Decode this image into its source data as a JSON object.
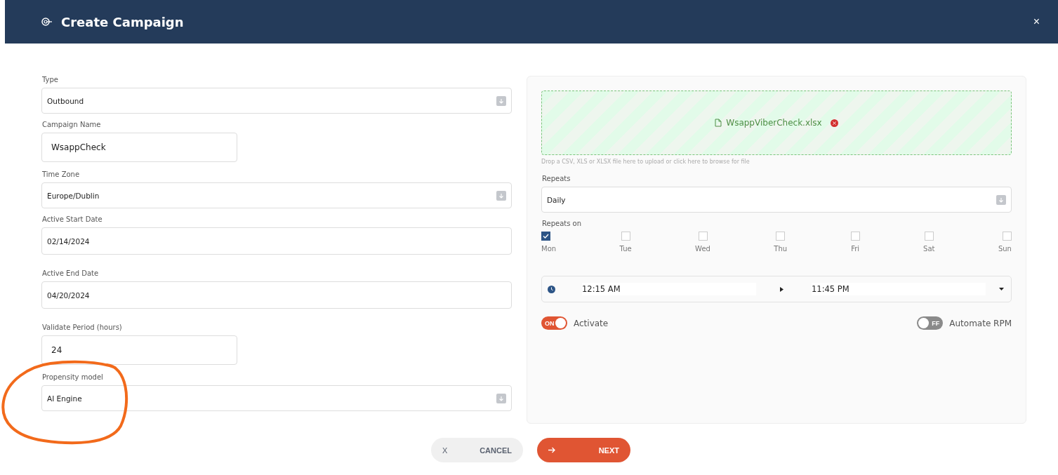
{
  "header": {
    "title": "Create Campaign",
    "close": "×"
  },
  "left_fields": [
    {
      "kind": "select",
      "label": "Type",
      "value": "Outbound"
    },
    {
      "kind": "input",
      "label": "Campaign Name",
      "value": "WsappCheck",
      "short": true
    },
    {
      "kind": "select",
      "label": "Time Zone",
      "value": "Europe/Dublin"
    },
    {
      "kind": "date",
      "label": "Active Start Date",
      "value": "02/14/2024"
    },
    {
      "kind": "date",
      "label": "Active End Date",
      "value": "04/20/2024"
    },
    {
      "kind": "input",
      "label": "Validate Period (hours)",
      "value": "24",
      "short": true
    },
    {
      "kind": "select",
      "label": "Propensity model",
      "value": "AI Engine",
      "circled": true
    }
  ],
  "upload": {
    "file": "WsappViberCheck.xlsx",
    "hint": "Drop a CSV, XLS or XLSX file here to upload or click here to browse for file"
  },
  "repeats": {
    "label": "Repeats",
    "value": "Daily"
  },
  "repeats_on": {
    "label": "Repeats on",
    "days": [
      {
        "label": "Mon",
        "checked": true
      },
      {
        "label": "Tue",
        "checked": false
      },
      {
        "label": "Wed",
        "checked": false
      },
      {
        "label": "Thu",
        "checked": false
      },
      {
        "label": "Fri",
        "checked": false
      },
      {
        "label": "Sat",
        "checked": false
      },
      {
        "label": "Sun",
        "checked": false
      }
    ]
  },
  "time_range": {
    "start": "12:15 AM",
    "end": "11:45 PM"
  },
  "toggles": [
    {
      "label": "Activate",
      "on": true,
      "text": "ON"
    },
    {
      "label": "Automate RPM",
      "on": false,
      "text": "FF"
    }
  ],
  "buttons": [
    {
      "kind": "cancel",
      "icon": "X",
      "label": "CANCEL"
    },
    {
      "kind": "next",
      "label": "NEXT"
    }
  ]
}
